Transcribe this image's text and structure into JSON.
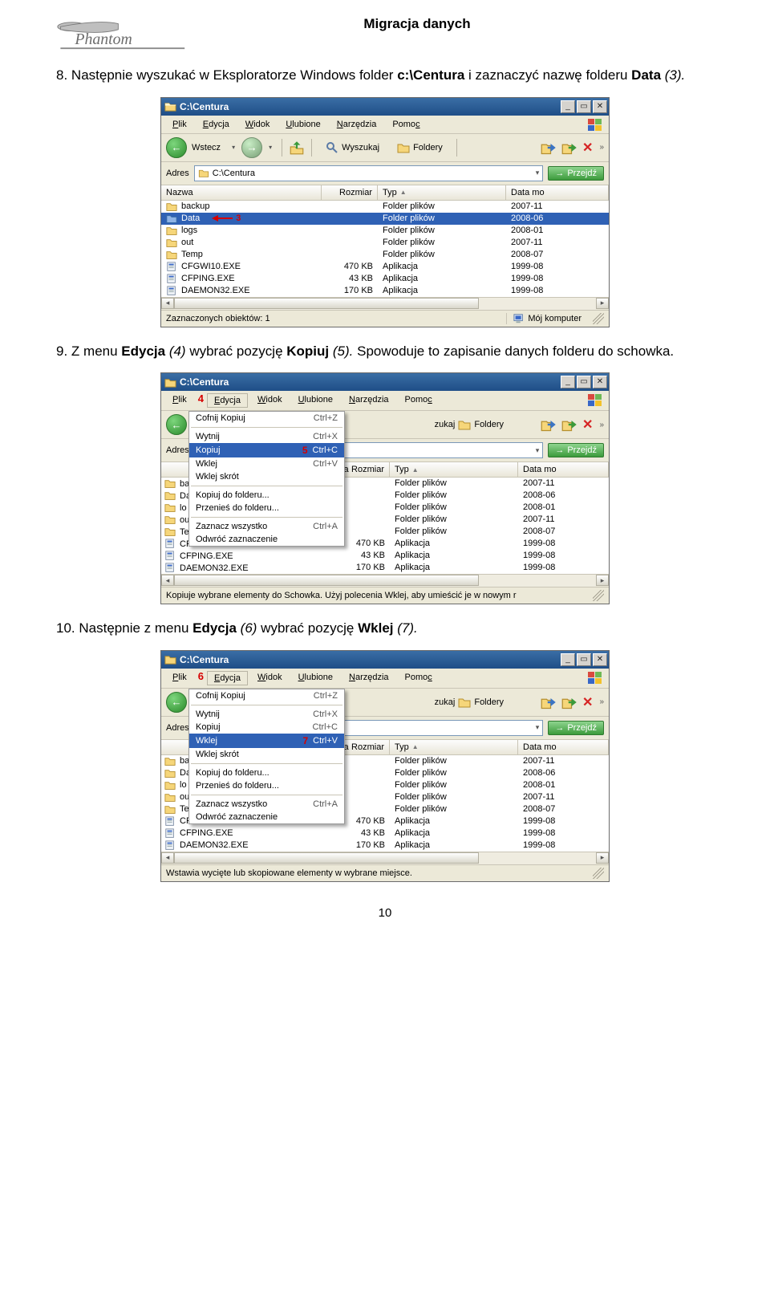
{
  "doc_title": "Migracja danych",
  "brand_text": "Phantom",
  "page_number": "10",
  "steps": {
    "s8": {
      "num": "8.",
      "t1": "Następnie wyszukać w Eksploratorze Windows folder ",
      "bold1": "c:\\Centura",
      "t2": " i zaznaczyć nazwę folderu ",
      "bold2": "Data",
      "italic": " (3).",
      "marker_label": "3"
    },
    "s9": {
      "num": "9.",
      "t1": "Z menu ",
      "bold1": "Edycja",
      "italic1": " (4) ",
      "t2": "wybrać pozycję ",
      "bold2": "Kopiuj",
      "italic2": " (5). ",
      "t3": "Spowoduje to zapisanie danych folderu do schowka."
    },
    "s10": {
      "num": "10.",
      "t1": "Następnie z menu ",
      "bold1": "Edycja",
      "italic1": " (6) ",
      "t2": "wybrać pozycję ",
      "bold2": "Wklej",
      "italic2": " (7)."
    }
  },
  "window_title": "C:\\Centura",
  "menubar": {
    "plik": "Plik",
    "edycja": "Edycja",
    "widok": "Widok",
    "ulubione": "Ulubione",
    "narzedzia": "Narzędzia",
    "pomoc": "Pomoc"
  },
  "markers": {
    "m4": "4",
    "m5": "5",
    "m6": "6",
    "m7": "7"
  },
  "toolbar": {
    "wstecz": "Wstecz",
    "wyszukaj": "Wyszukaj",
    "foldery": "Foldery"
  },
  "addr": {
    "label": "Adres",
    "value": "C:\\Centura",
    "go": "Przejdź"
  },
  "columns": {
    "nazwa": "Nazwa",
    "rozmiar": "Rozmiar",
    "typ": "Typ",
    "data": "Data mo"
  },
  "rows": [
    {
      "name": "backup",
      "size": "",
      "type": "Folder plików",
      "date": "2007-11",
      "icon": "folder"
    },
    {
      "name": "Data",
      "size": "",
      "type": "Folder plików",
      "date": "2008-06",
      "icon": "folder",
      "sel": true
    },
    {
      "name": "logs",
      "size": "",
      "type": "Folder plików",
      "date": "2008-01",
      "icon": "folder"
    },
    {
      "name": "out",
      "size": "",
      "type": "Folder plików",
      "date": "2007-11",
      "icon": "folder"
    },
    {
      "name": "Temp",
      "size": "",
      "type": "Folder plików",
      "date": "2008-07",
      "icon": "folder"
    },
    {
      "name": "CFGWI10.EXE",
      "size": "470 KB",
      "type": "Aplikacja",
      "date": "1999-08",
      "icon": "exe"
    },
    {
      "name": "CFPING.EXE",
      "size": "43 KB",
      "type": "Aplikacja",
      "date": "1999-08",
      "icon": "exe"
    },
    {
      "name": "DAEMON32.EXE",
      "size": "170 KB",
      "type": "Aplikacja",
      "date": "1999-08",
      "icon": "exe"
    }
  ],
  "rows_trunc": [
    {
      "name": "ba",
      "type": "Folder plików",
      "date": "2007-11",
      "icon": "folder"
    },
    {
      "name": "Da",
      "type": "Folder plików",
      "date": "2008-06",
      "icon": "folder",
      "sel": true
    },
    {
      "name": "lo",
      "type": "Folder plików",
      "date": "2008-01",
      "icon": "folder"
    },
    {
      "name": "ou",
      "type": "Folder plików",
      "date": "2007-11",
      "icon": "folder"
    },
    {
      "name": "Te",
      "type": "Folder plików",
      "date": "2008-07",
      "icon": "folder"
    },
    {
      "name": "CF",
      "size": "470 KB",
      "type": "Aplikacja",
      "date": "1999-08",
      "icon": "exe"
    },
    {
      "name": "CFPING.EXE",
      "size": "43 KB",
      "type": "Aplikacja",
      "date": "1999-08",
      "icon": "exe"
    },
    {
      "name": "DAEMON32.EXE",
      "size": "170 KB",
      "type": "Aplikacja",
      "date": "1999-08",
      "icon": "exe"
    }
  ],
  "status": {
    "win1_left": "Zaznaczonych obiektów: 1",
    "moj_komputer": "Mój komputer",
    "win2": "Kopiuje wybrane elementy do Schowka. Użyj polecenia Wklej, aby umieścić je w nowym r",
    "win3": "Wstawia wycięte lub skopiowane elementy w wybrane miejsce."
  },
  "edit_menu": [
    {
      "label": "Cofnij Kopiuj",
      "shortcut": "Ctrl+Z"
    },
    {
      "sep": true
    },
    {
      "label": "Wytnij",
      "shortcut": "Ctrl+X"
    },
    {
      "label": "Kopiuj",
      "shortcut": "Ctrl+C",
      "hl_for": "5"
    },
    {
      "label": "Wklej",
      "shortcut": "Ctrl+V",
      "hl_for": "7"
    },
    {
      "label": "Wklej skrót",
      "shortcut": ""
    },
    {
      "sep": true
    },
    {
      "label": "Kopiuj do folderu...",
      "shortcut": ""
    },
    {
      "label": "Przenieś do folderu...",
      "shortcut": ""
    },
    {
      "sep": true
    },
    {
      "label": "Zaznacz wszystko",
      "shortcut": "Ctrl+A"
    },
    {
      "label": "Odwróć zaznaczenie",
      "shortcut": ""
    }
  ]
}
